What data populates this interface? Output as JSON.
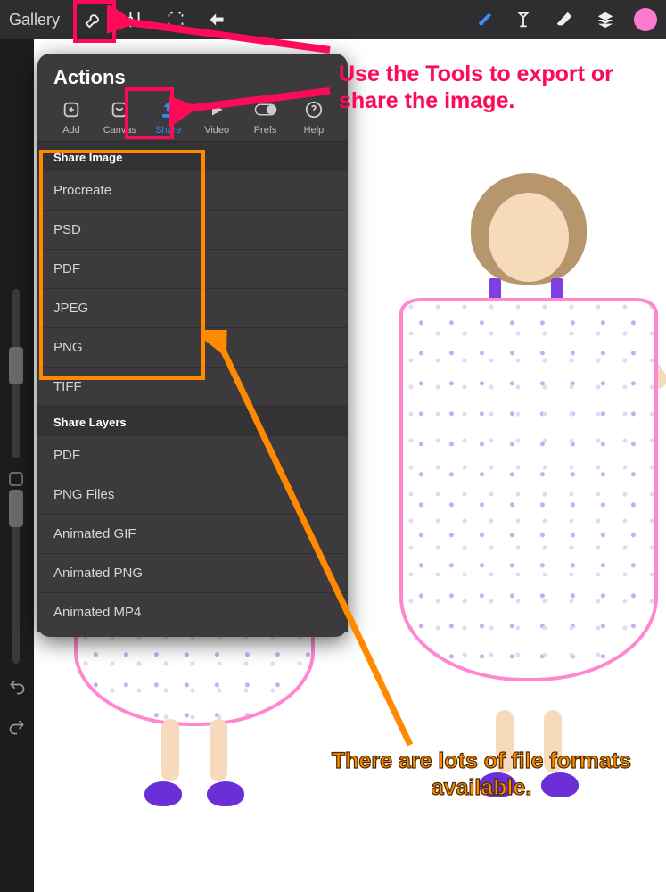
{
  "topbar": {
    "gallery_label": "Gallery"
  },
  "panel": {
    "title": "Actions",
    "tabs": {
      "add": {
        "label": "Add"
      },
      "canvas": {
        "label": "Canvas"
      },
      "share": {
        "label": "Share"
      },
      "video": {
        "label": "Video"
      },
      "prefs": {
        "label": "Prefs"
      },
      "help": {
        "label": "Help"
      }
    },
    "share_image_header": "Share Image",
    "share_image_options": [
      "Procreate",
      "PSD",
      "PDF",
      "JPEG",
      "PNG",
      "TIFF"
    ],
    "share_layers_header": "Share Layers",
    "share_layers_options": [
      "PDF",
      "PNG Files",
      "Animated GIF",
      "Animated PNG",
      "Animated MP4"
    ]
  },
  "annotations": {
    "tools_text": "Use the Tools to export or share the image.",
    "formats_text": "There are lots of file formats available."
  },
  "colors": {
    "highlight_pink": "#ff0a57",
    "highlight_orange": "#ff8a00",
    "brush_color": "#ff7ace",
    "active_blue": "#2a8cff"
  }
}
